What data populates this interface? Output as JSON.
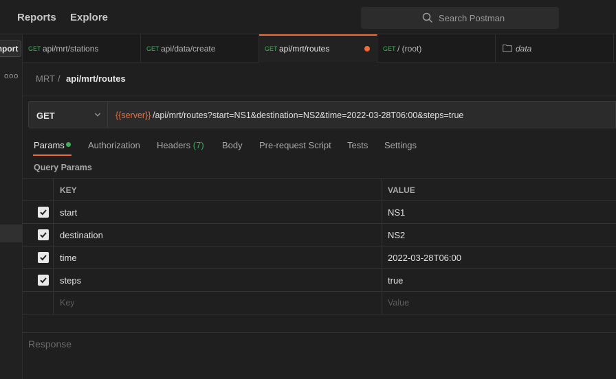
{
  "topbar": {
    "nav": [
      "Reports",
      "Explore"
    ],
    "search_placeholder": "Search Postman"
  },
  "sidebar": {
    "import_label": "Import",
    "more_label": "ooo"
  },
  "tabs": [
    {
      "method": "GET",
      "name": "api/mrt/stations",
      "active": false
    },
    {
      "method": "GET",
      "name": "api/data/create",
      "active": false
    },
    {
      "method": "GET",
      "name": "api/mrt/routes",
      "active": true,
      "unsaved": true
    },
    {
      "method": "GET",
      "name": "/ (root)",
      "active": false
    },
    {
      "method": "",
      "name": "data",
      "icon": "folder-icon",
      "active": false
    }
  ],
  "breadcrumb": {
    "root": "MRT",
    "separator": "/",
    "current": "api/mrt/routes"
  },
  "request": {
    "method": "GET",
    "url_variable": "{{server}}",
    "url_path": "/api/mrt/routes?start=NS1&destination=NS2&time=2022-03-28T06:00&steps=true"
  },
  "request_tabs": {
    "params": "Params",
    "authorization": "Authorization",
    "headers": "Headers",
    "headers_count": "(7)",
    "body": "Body",
    "pre_request": "Pre-request Script",
    "tests": "Tests",
    "settings": "Settings"
  },
  "query_params": {
    "title": "Query Params",
    "key_header": "KEY",
    "value_header": "VALUE",
    "rows": [
      {
        "key": "start",
        "value": "NS1",
        "checked": true
      },
      {
        "key": "destination",
        "value": "NS2",
        "checked": true
      },
      {
        "key": "time",
        "value": "2022-03-28T06:00",
        "checked": true
      },
      {
        "key": "steps",
        "value": "true",
        "checked": true
      }
    ],
    "key_placeholder": "Key",
    "value_placeholder": "Value"
  },
  "response": {
    "label": "Response"
  },
  "colors": {
    "accent": "#f26b3a",
    "method_green": "#3fae5a",
    "background": "#1f1f1f"
  }
}
